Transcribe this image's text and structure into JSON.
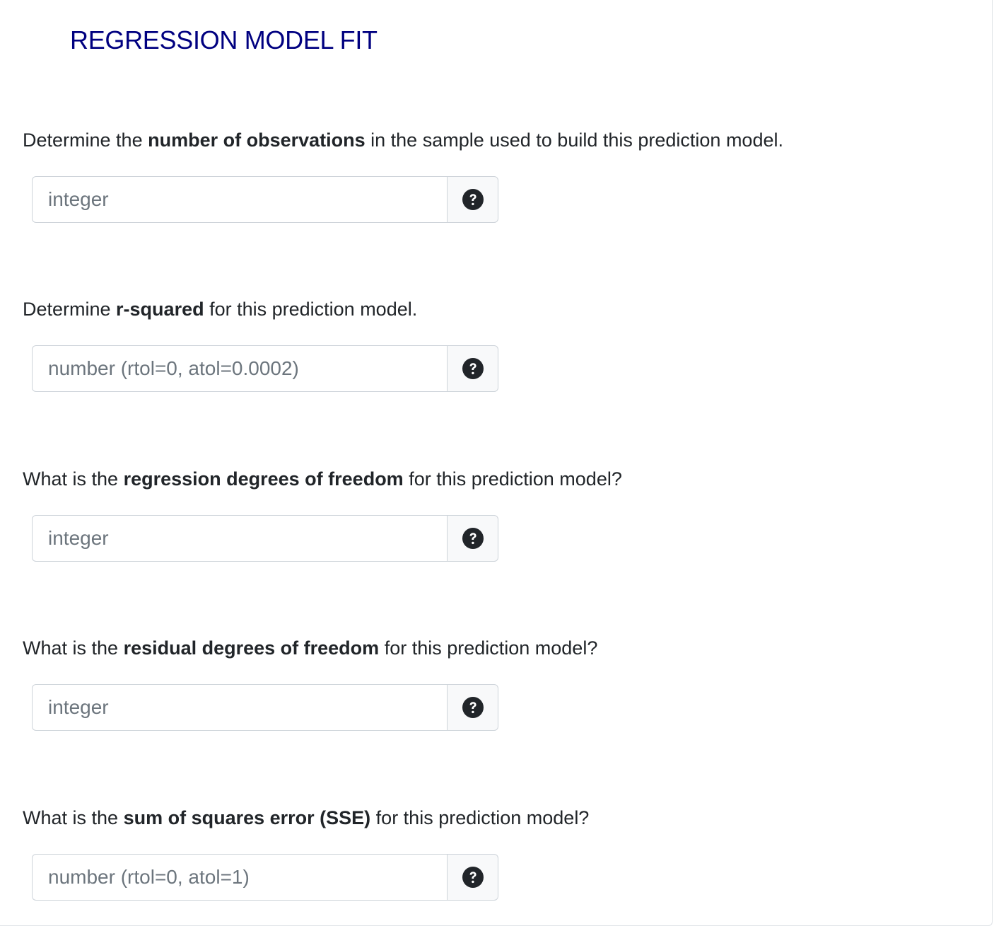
{
  "title": "REGRESSION MODEL FIT",
  "questions": [
    {
      "prefix": "Determine the ",
      "bold": "number of observations",
      "suffix": " in the sample used to build this prediction model.",
      "placeholder": "integer"
    },
    {
      "prefix": "Determine ",
      "bold": "r-squared",
      "suffix": " for this prediction model.",
      "placeholder": "number (rtol=0, atol=0.0002)"
    },
    {
      "prefix": "What is the ",
      "bold": "regression degrees of freedom",
      "suffix": " for this prediction model?",
      "placeholder": "integer"
    },
    {
      "prefix": "What is the ",
      "bold": "residual degrees of freedom",
      "suffix": " for this prediction model?",
      "placeholder": "integer"
    },
    {
      "prefix": "What is the ",
      "bold": "sum of squares error (SSE)",
      "suffix": " for this prediction model?",
      "placeholder": "number (rtol=0, atol=1)"
    }
  ],
  "help_icon": "question-circle-icon"
}
